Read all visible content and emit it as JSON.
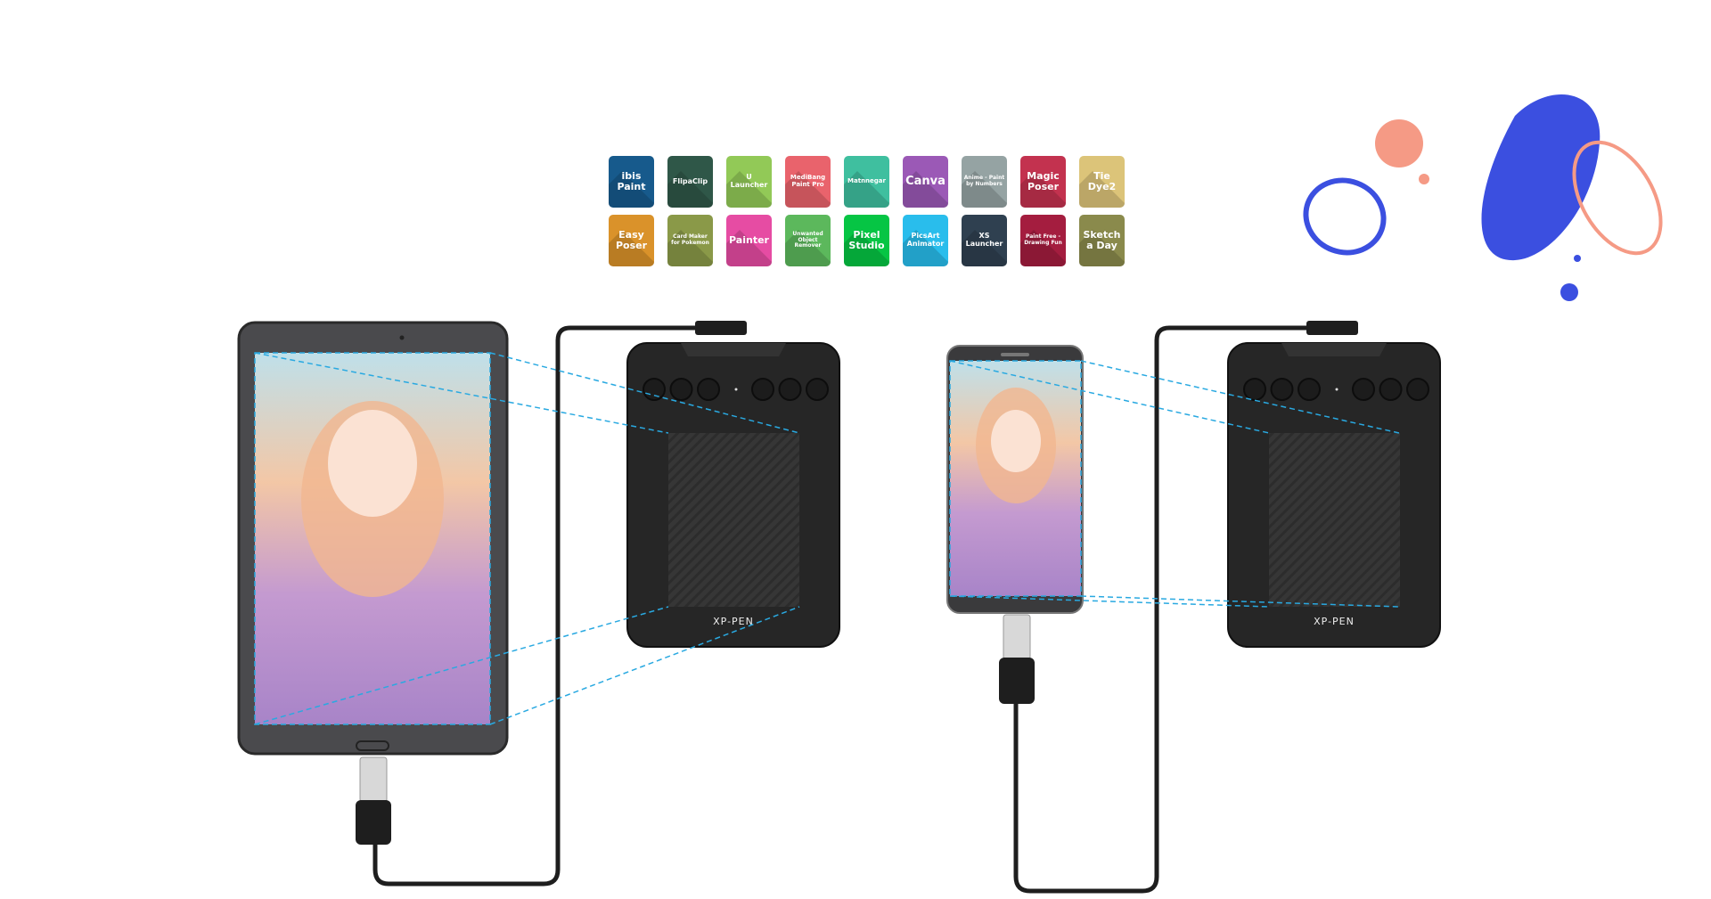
{
  "apps": [
    {
      "label": "ibis Paint",
      "color": "#175a8c",
      "size": 11
    },
    {
      "label": "FlipaClip",
      "color": "#2f5748",
      "size": 8
    },
    {
      "label": "U Launcher",
      "color": "#92c957",
      "size": 8
    },
    {
      "label": "MediBang Paint Pro",
      "color": "#e9636c",
      "size": 7
    },
    {
      "label": "Matnnegar",
      "color": "#3fbf9f",
      "size": 7
    },
    {
      "label": "Canva",
      "color": "#9b59b6",
      "size": 13
    },
    {
      "label": "Anime - Paint by Numbers",
      "color": "#95a3a3",
      "size": 6
    },
    {
      "label": "Magic Poser",
      "color": "#c3324f",
      "size": 11
    },
    {
      "label": "Tie Dye2",
      "color": "#dcc479",
      "size": 11
    },
    {
      "label": "Easy Poser",
      "color": "#da922a",
      "size": 11
    },
    {
      "label": "Card Maker for Pokemon",
      "color": "#8a9948",
      "size": 6
    },
    {
      "label": "Painter",
      "color": "#e64ca3",
      "size": 11
    },
    {
      "label": "Unwanted Object Remover",
      "color": "#5cb85c",
      "size": 6
    },
    {
      "label": "Pixel Studio",
      "color": "#06c544",
      "size": 11
    },
    {
      "label": "PicsArt Animator",
      "color": "#29bdec",
      "size": 8
    },
    {
      "label": "XS Launcher",
      "color": "#2f4050",
      "size": 8
    },
    {
      "label": "Paint Free - Drawing Fun",
      "color": "#a41d3f",
      "size": 6
    },
    {
      "label": "Sketch a Day",
      "color": "#8a8a4c",
      "size": 11
    }
  ],
  "tablets": {
    "brand": "XP-PEN"
  },
  "colors": {
    "projection": "#29a9e1",
    "blob_blue": "#3b4fe0",
    "blob_salmon": "#f59a85",
    "device": "#2a2a2a"
  }
}
